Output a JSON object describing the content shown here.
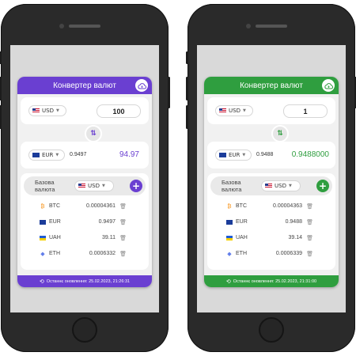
{
  "screens": [
    {
      "theme": "purple",
      "accent": "#6a3fd1",
      "accent_text": "#6a3fd1",
      "title": "Конвертер валют",
      "from_currency": "USD",
      "from_amount": "100",
      "to_currency": "EUR",
      "rate": "0.9497",
      "result": "94.97",
      "base_label": "Базова валюта",
      "base_currency": "USD",
      "rows": [
        {
          "icon": "bitcoin-icon",
          "code": "BTC",
          "value": "0.00004361"
        },
        {
          "icon": "eu-flag-icon",
          "code": "EUR",
          "value": "0.9497"
        },
        {
          "icon": "ua-flag-icon",
          "code": "UAH",
          "value": "39.11"
        },
        {
          "icon": "ethereum-icon",
          "code": "ETH",
          "value": "0.0006332"
        }
      ],
      "footer": "Останнє оновлення: 25.02.2023, 21:26:31"
    },
    {
      "theme": "green",
      "accent": "#2f9e3f",
      "accent_text": "#2f9e3f",
      "title": "Конвертер валют",
      "from_currency": "USD",
      "from_amount": "1",
      "to_currency": "EUR",
      "rate": "0.9488",
      "result": "0.9488000",
      "base_label": "Базова валюта",
      "base_currency": "USD",
      "rows": [
        {
          "icon": "bitcoin-icon",
          "code": "BTC",
          "value": "0.00004363"
        },
        {
          "icon": "eu-flag-icon",
          "code": "EUR",
          "value": "0.9488"
        },
        {
          "icon": "ua-flag-icon",
          "code": "UAH",
          "value": "39.14"
        },
        {
          "icon": "ethereum-icon",
          "code": "ETH",
          "value": "0.0006339"
        }
      ],
      "footer": "Останнє оновлення: 25.02.2023, 21:31:00"
    }
  ]
}
